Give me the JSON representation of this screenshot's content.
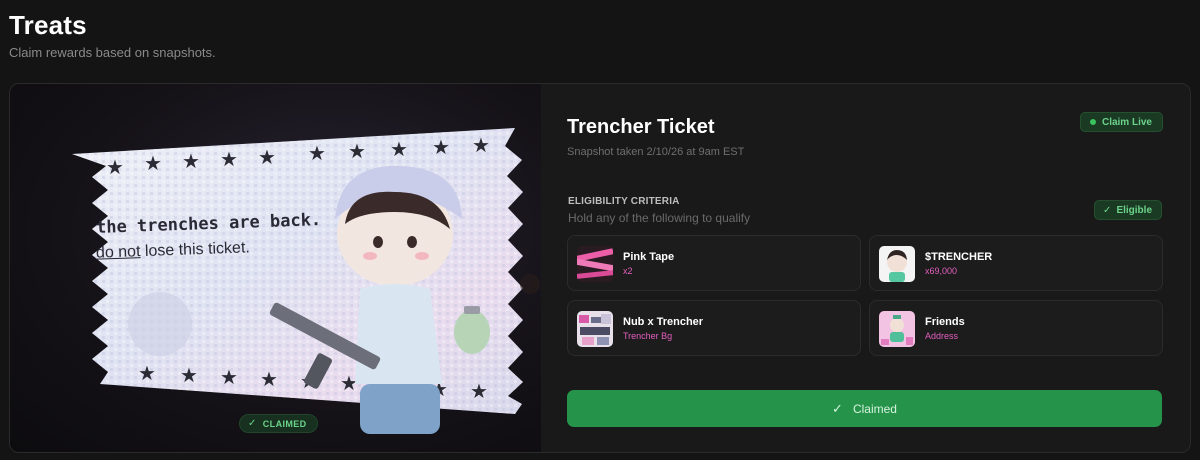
{
  "page": {
    "title": "Treats",
    "subtitle": "Claim rewards based on snapshots."
  },
  "media": {
    "ticket_line1": "the trenches are back.",
    "ticket_line2_underlined": "do not",
    "ticket_line2_rest": " lose this ticket.",
    "claimed_label": "CLAIMED"
  },
  "details": {
    "title": "Trencher Ticket",
    "snapshot": "Snapshot taken 2/10/26 at 9am EST",
    "status": "Claim Live",
    "criteria_title": "ELIGIBILITY CRITERIA",
    "criteria_subtitle": "Hold any of the following to qualify",
    "eligible_label": "Eligible",
    "items": [
      {
        "name": "Pink Tape",
        "sub": "x2"
      },
      {
        "name": "$TRENCHER",
        "sub": "x69,000"
      },
      {
        "name": "Nub x Trencher",
        "sub": "Trencher Bg"
      },
      {
        "name": "Friends",
        "sub": "Address"
      }
    ],
    "button_label": "Claimed"
  },
  "colors": {
    "accent_green": "#25944a",
    "badge_text": "#6bd38a",
    "item_sub_pink": "#e35fbf"
  }
}
